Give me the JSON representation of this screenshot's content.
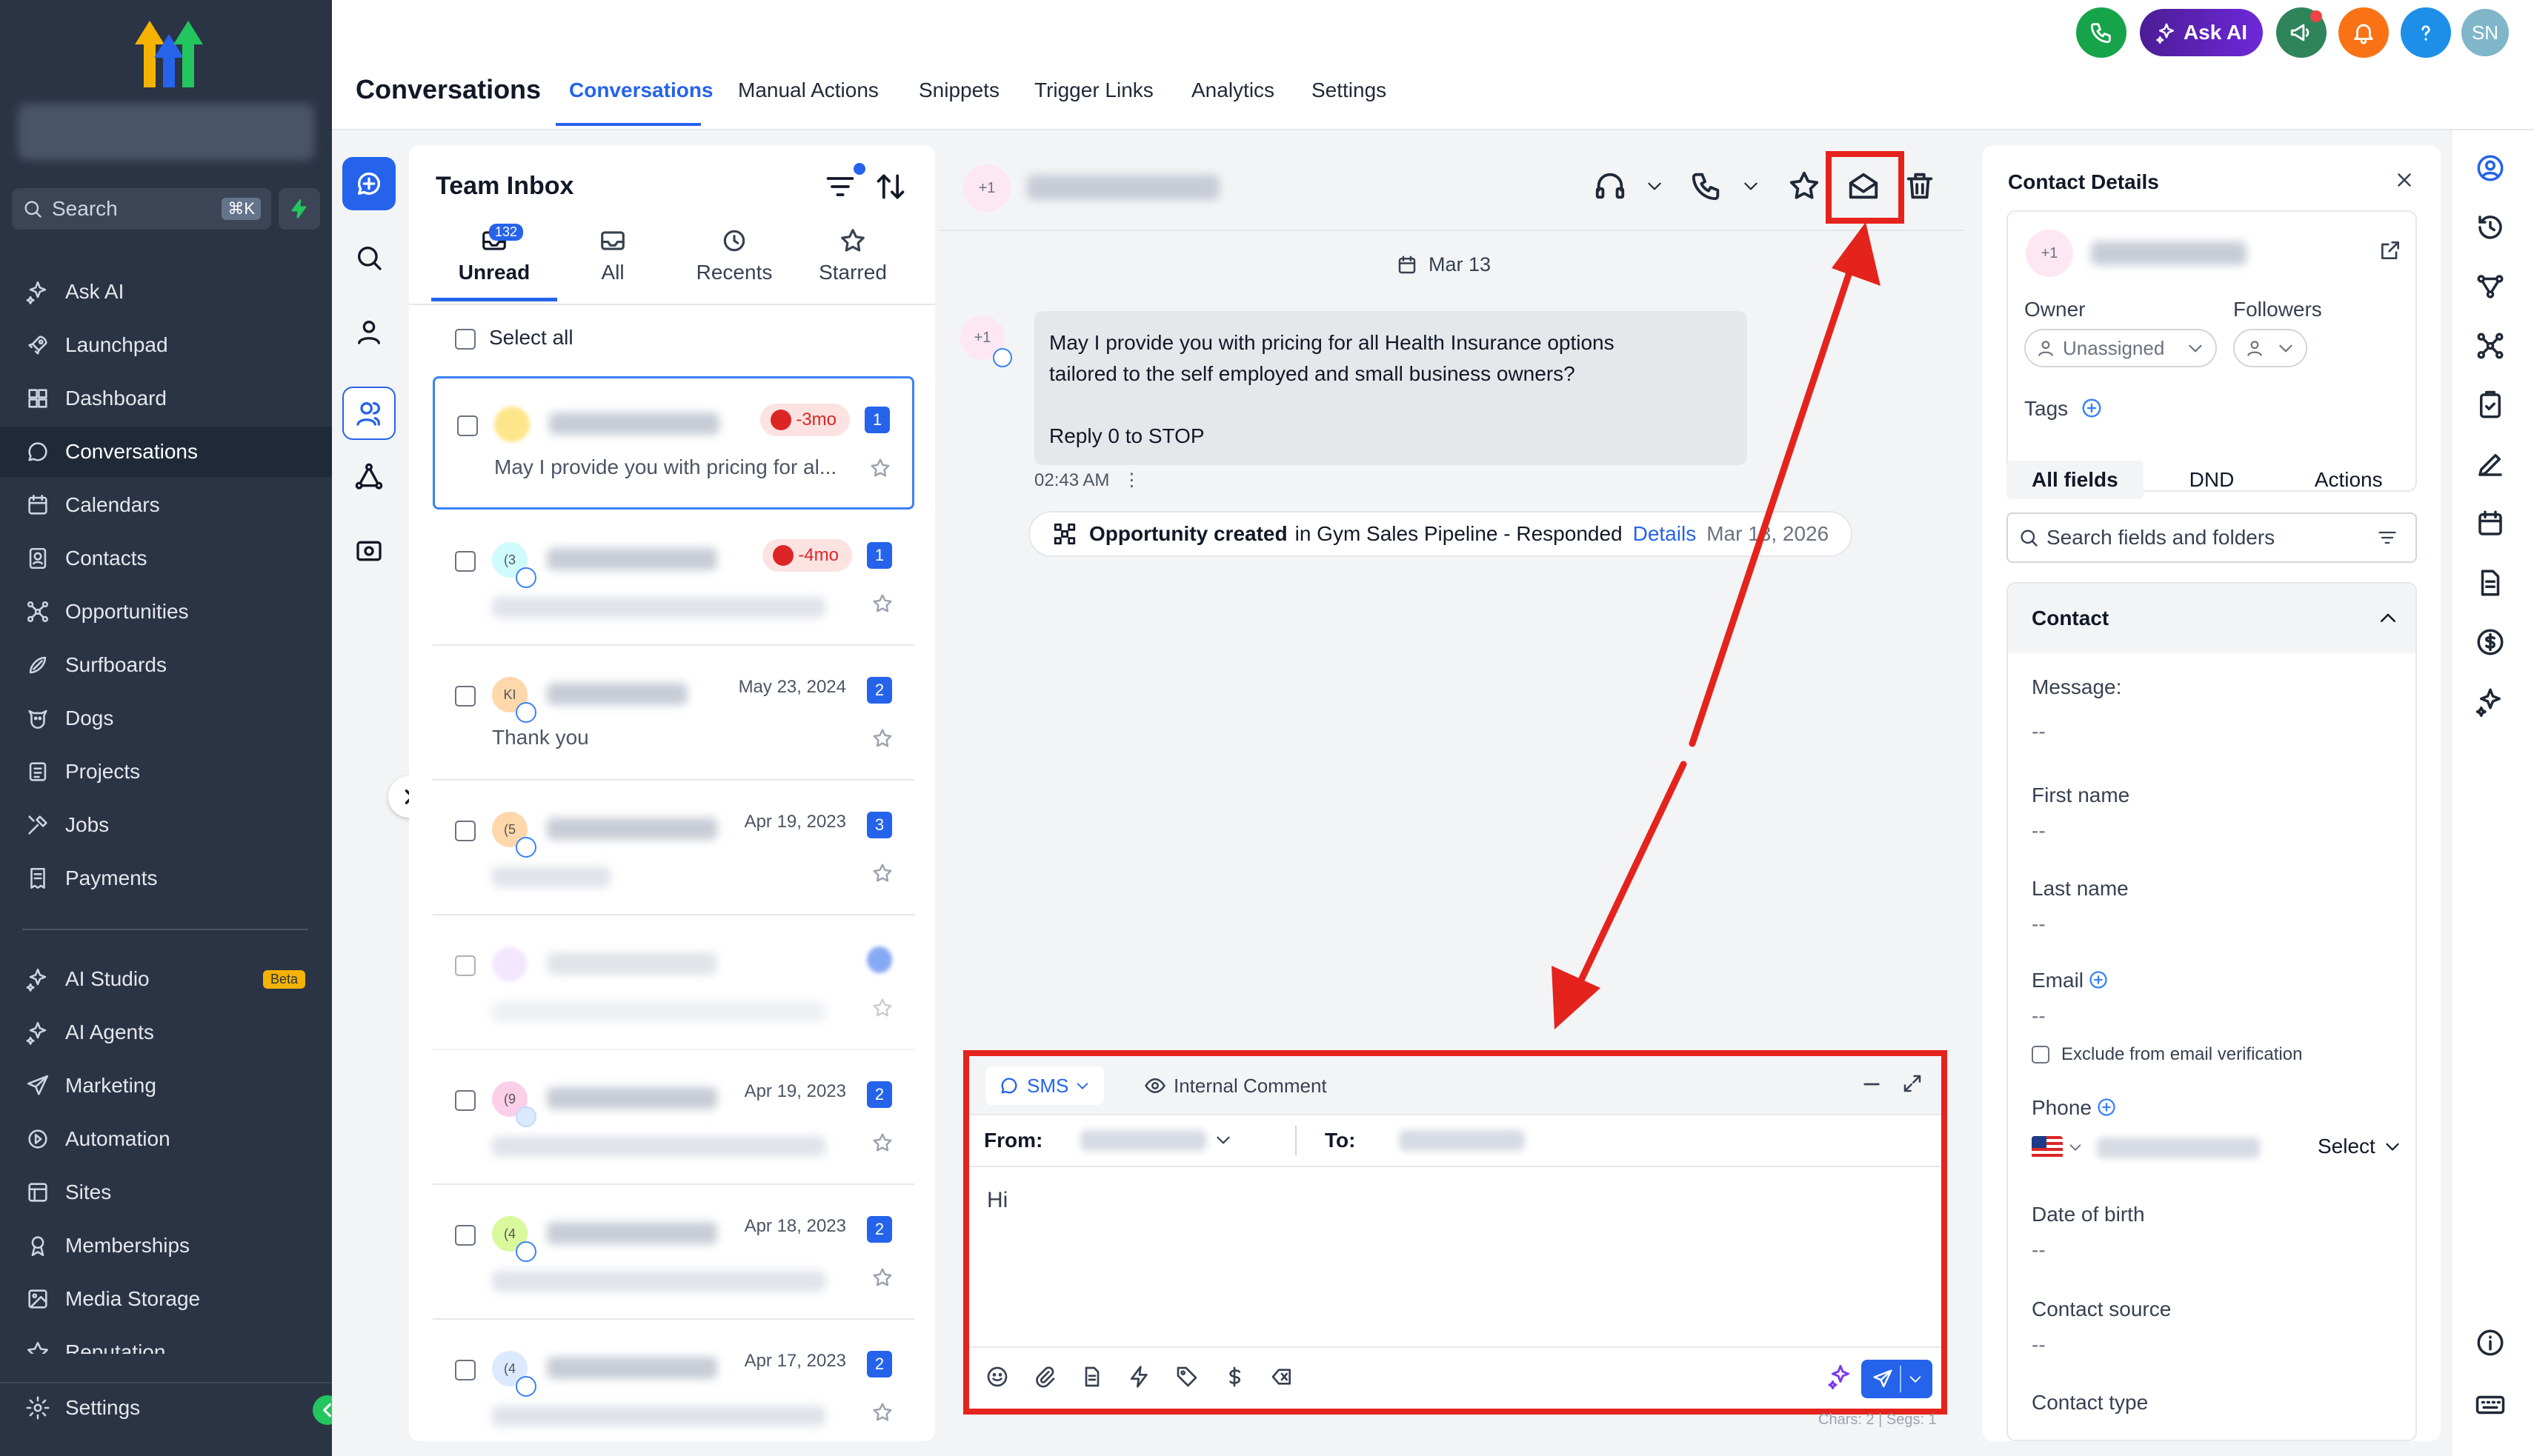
{
  "app": {
    "page_title": "Conversations",
    "top_tabs": [
      "Conversations",
      "Manual Actions",
      "Snippets",
      "Trigger Links",
      "Analytics",
      "Settings"
    ],
    "ask_ai": "Ask AI",
    "user_initials": "SN",
    "colors": {
      "accent": "#2563eb",
      "sidebar": "#2b3445",
      "highlight": "#e5231d",
      "ai_purple": "#5b21b6",
      "call_green": "#16a34a",
      "bell_orange": "#f97316"
    }
  },
  "sidebar": {
    "search_placeholder": "Search",
    "search_shortcut": "⌘K",
    "items": [
      {
        "label": "Ask AI",
        "icon": "sparkle-icon"
      },
      {
        "label": "Launchpad",
        "icon": "rocket-icon"
      },
      {
        "label": "Dashboard",
        "icon": "grid-icon"
      },
      {
        "label": "Conversations",
        "icon": "chat-icon",
        "active": true
      },
      {
        "label": "Calendars",
        "icon": "calendar-icon"
      },
      {
        "label": "Contacts",
        "icon": "contacts-icon"
      },
      {
        "label": "Opportunities",
        "icon": "network-icon"
      },
      {
        "label": "Surfboards",
        "icon": "surfboard-icon"
      },
      {
        "label": "Dogs",
        "icon": "dog-icon"
      },
      {
        "label": "Projects",
        "icon": "folder-icon"
      },
      {
        "label": "Jobs",
        "icon": "tools-icon"
      },
      {
        "label": "Payments",
        "icon": "receipt-icon"
      }
    ],
    "items2": [
      {
        "label": "AI Studio",
        "icon": "ai-studio-icon",
        "badge": "Beta"
      },
      {
        "label": "AI Agents",
        "icon": "sparkle-icon"
      },
      {
        "label": "Marketing",
        "icon": "send-icon"
      },
      {
        "label": "Automation",
        "icon": "automation-icon"
      },
      {
        "label": "Sites",
        "icon": "sites-icon"
      },
      {
        "label": "Memberships",
        "icon": "award-icon"
      },
      {
        "label": "Media Storage",
        "icon": "image-icon"
      },
      {
        "label": "Reputation",
        "icon": "star-icon"
      }
    ],
    "settings": "Settings"
  },
  "inbox": {
    "title": "Team Inbox",
    "tabs": [
      {
        "label": "Unread",
        "count": "132"
      },
      {
        "label": "All"
      },
      {
        "label": "Recents"
      },
      {
        "label": "Starred"
      }
    ],
    "select_all": "Select all",
    "rows": [
      {
        "avatar": "",
        "late": "-3mo",
        "count": "1",
        "preview": "May I provide you with pricing for al..."
      },
      {
        "avatar": "(3",
        "late": "-4mo",
        "count": "1",
        "preview": ""
      },
      {
        "avatar": "KI",
        "date": "May 23, 2024",
        "count": "2",
        "preview": "Thank you"
      },
      {
        "avatar": "(5",
        "date": "Apr 19, 2023",
        "count": "3",
        "preview": ""
      },
      {
        "avatar": "",
        "date": "",
        "count": "",
        "preview": ""
      },
      {
        "avatar": "(9",
        "date": "Apr 19, 2023",
        "count": "2",
        "preview": ""
      },
      {
        "avatar": "(4",
        "date": "Apr 18, 2023",
        "count": "2",
        "preview": ""
      },
      {
        "avatar": "(4",
        "date": "Apr 17, 2023",
        "count": "2",
        "preview": ""
      }
    ]
  },
  "chat": {
    "avatar": "+1",
    "date_divider": "Mar 13",
    "message": {
      "avatar": "+1",
      "lines": [
        "May I provide you with pricing for all Health Insurance options",
        "tailored to the self employed and small business owners?",
        "Reply 0 to STOP"
      ],
      "time": "02:43 AM"
    },
    "opportunity": {
      "bold": "Opportunity created",
      "text": "in Gym Sales Pipeline - Responded",
      "link": "Details",
      "when": "Mar 13, 2026"
    },
    "composer": {
      "channel": "SMS",
      "internal": "Internal Comment",
      "from_label": "From:",
      "to_label": "To:",
      "text": "Hi",
      "chars": "Chars: 2 | Segs: 1"
    }
  },
  "contact": {
    "title": "Contact Details",
    "avatar": "+1",
    "owner_label": "Owner",
    "owner_value": "Unassigned",
    "followers_label": "Followers",
    "tags_label": "Tags",
    "tabs": [
      "All fields",
      "DND",
      "Actions"
    ],
    "search_placeholder": "Search fields and folders",
    "section": "Contact",
    "fields": [
      {
        "label": "Message:",
        "value": "--"
      },
      {
        "label": "First name",
        "value": "--"
      },
      {
        "label": "Last name",
        "value": "--"
      },
      {
        "label": "Email",
        "value": "--"
      },
      {
        "label": "Phone",
        "value": ""
      },
      {
        "label": "Date of birth",
        "value": "--"
      },
      {
        "label": "Contact source",
        "value": "--"
      },
      {
        "label": "Contact type",
        "value": ""
      }
    ],
    "exclude_label": "Exclude from email verification",
    "phone_select": "Select"
  }
}
